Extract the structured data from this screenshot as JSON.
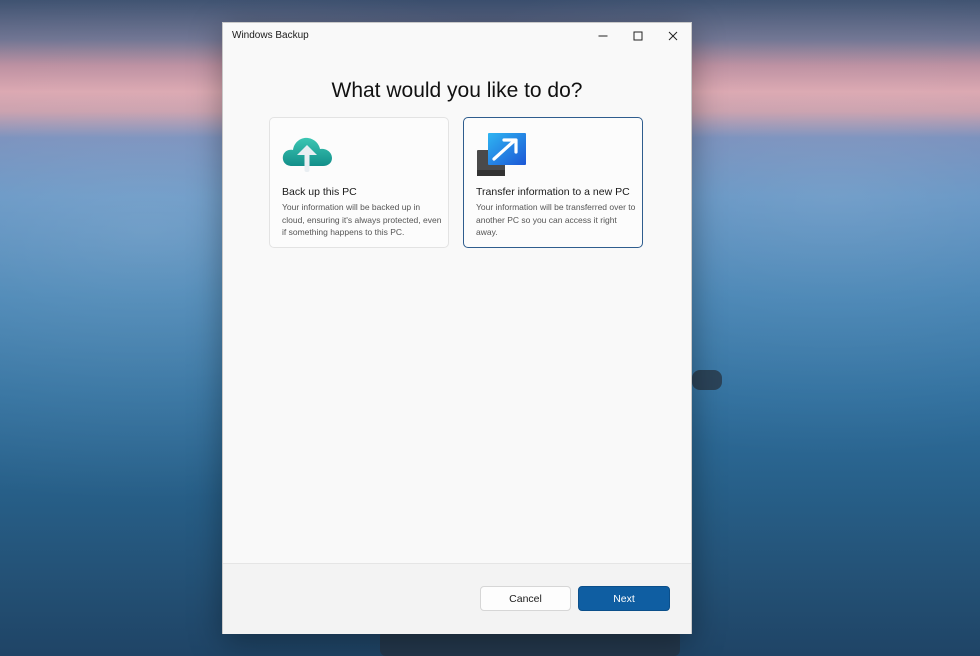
{
  "window": {
    "title": "Windows Backup",
    "controls": {
      "minimize_icon": "minimize-icon",
      "maximize_icon": "maximize-icon",
      "close_icon": "close-icon"
    }
  },
  "main": {
    "heading": "What would you like to do?",
    "options": [
      {
        "title": "Back up this PC",
        "description": "Your information will be backed up in cloud, ensuring it's always protected, even if something happens to this PC.",
        "icon": "cloud-upload-icon",
        "selected": false
      },
      {
        "title": "Transfer information to a new PC",
        "description": "Your information will be transferred over to another PC so you can access it right away.",
        "icon": "transfer-pc-icon",
        "selected": true
      }
    ]
  },
  "footer": {
    "cancel_label": "Cancel",
    "next_label": "Next"
  },
  "colors": {
    "accent": "#0f5ea2",
    "selected_border": "#2f5d8e",
    "cloud": "#1ea39a"
  }
}
